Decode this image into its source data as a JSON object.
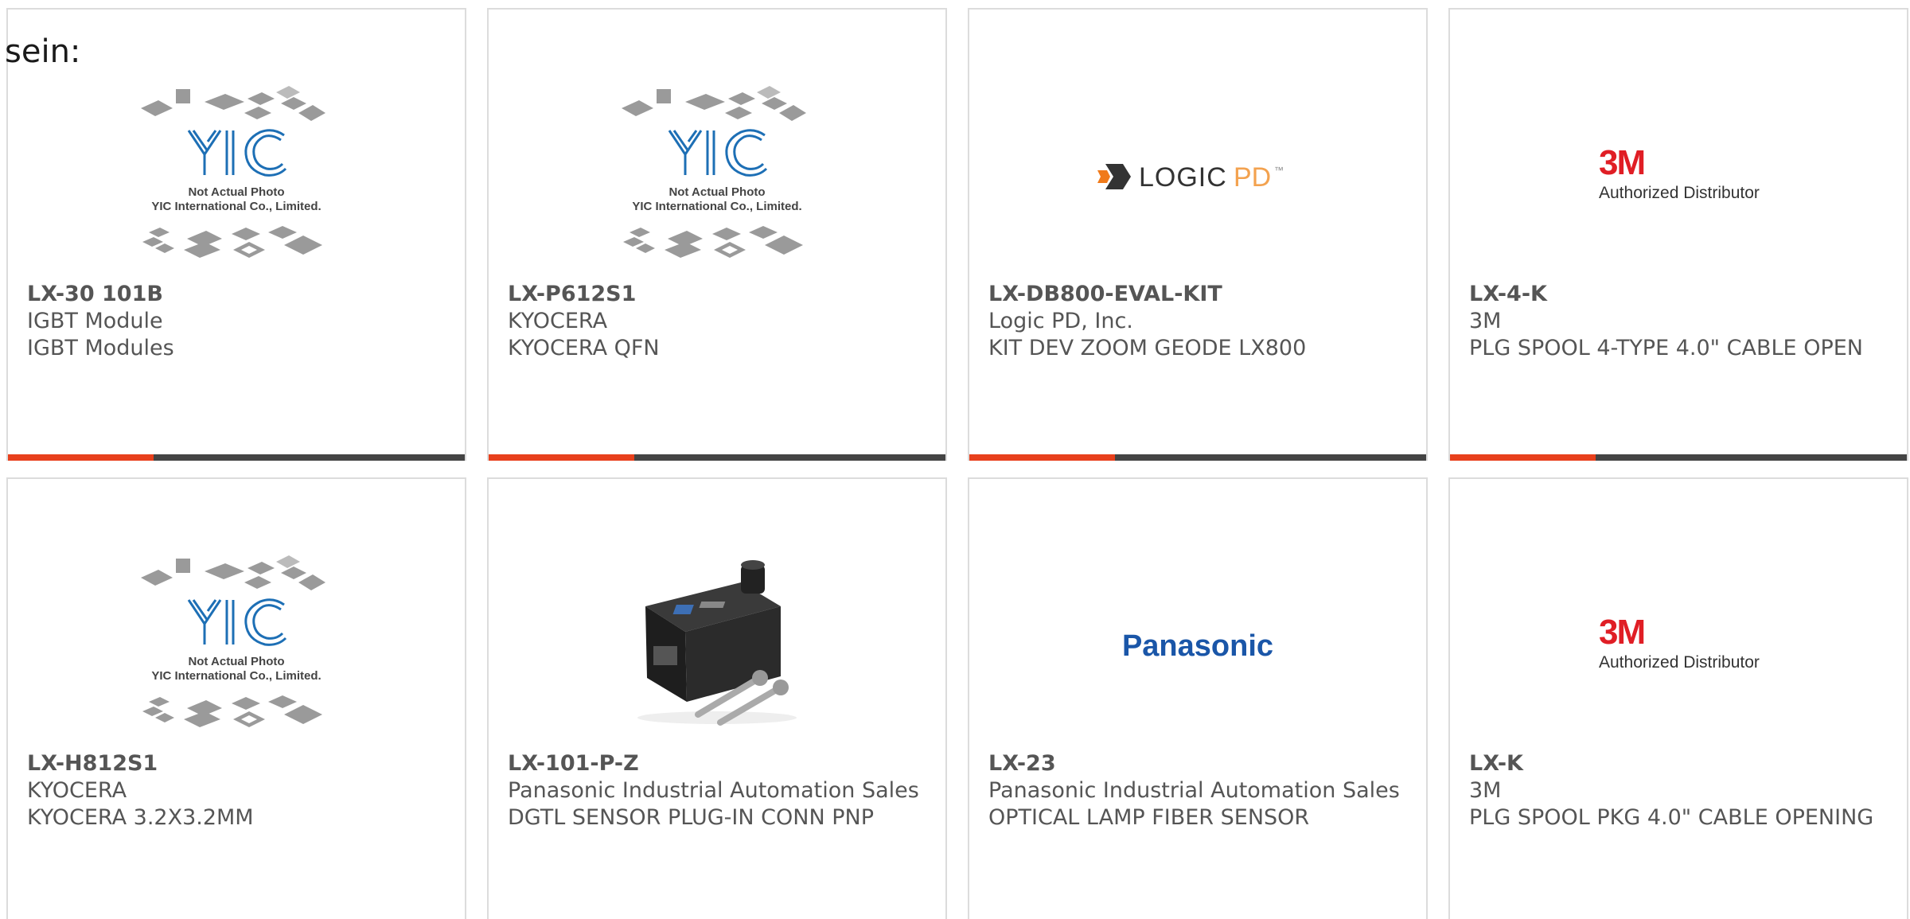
{
  "stray_text": "sein:",
  "colors": {
    "accent": "#e8401c",
    "bar": "#444444",
    "border": "#dcdcdc",
    "text": "#555555"
  },
  "products": [
    {
      "part_number": "LX-30 101B",
      "manufacturer": "IGBT Module",
      "description": "IGBT Modules",
      "image": "yic-placeholder",
      "image_text": {
        "logo": "YIC",
        "line1": "Not Actual Photo",
        "line2": "YIC International Co., Limited."
      }
    },
    {
      "part_number": "LX-P612S1",
      "manufacturer": "KYOCERA",
      "description": "KYOCERA QFN",
      "image": "yic-placeholder",
      "image_text": {
        "logo": "YIC",
        "line1": "Not Actual Photo",
        "line2": "YIC International Co., Limited."
      }
    },
    {
      "part_number": "LX-DB800-EVAL-KIT",
      "manufacturer": "Logic PD, Inc.",
      "description": "KIT DEV ZOOM GEODE LX800",
      "image": "logicpd-logo",
      "image_text": {
        "logo_a": "LOGIC",
        "logo_b": "PD",
        "tm": "™"
      }
    },
    {
      "part_number": "LX-4-K",
      "manufacturer": "3M",
      "description": "PLG SPOOL 4-TYPE 4.0\" CABLE OPEN",
      "image": "3m-logo",
      "image_text": {
        "logo": "3M",
        "line1": "Authorized Distributor"
      }
    },
    {
      "part_number": "LX-H812S1",
      "manufacturer": "KYOCERA",
      "description": "KYOCERA 3.2X3.2MM",
      "image": "yic-placeholder",
      "image_text": {
        "logo": "YIC",
        "line1": "Not Actual Photo",
        "line2": "YIC International Co., Limited."
      }
    },
    {
      "part_number": "LX-101-P-Z",
      "manufacturer": "Panasonic Industrial Automation Sales",
      "description": "DGTL SENSOR PLUG-IN CONN PNP",
      "image": "sensor-photo",
      "image_text": {}
    },
    {
      "part_number": "LX-23",
      "manufacturer": "Panasonic Industrial Automation Sales",
      "description": "OPTICAL LAMP FIBER SENSOR",
      "image": "panasonic-logo",
      "image_text": {
        "logo": "Panasonic"
      }
    },
    {
      "part_number": "LX-K",
      "manufacturer": "3M",
      "description": "PLG SPOOL PKG 4.0\" CABLE OPENING",
      "image": "3m-logo",
      "image_text": {
        "logo": "3M",
        "line1": "Authorized Distributor"
      }
    }
  ]
}
